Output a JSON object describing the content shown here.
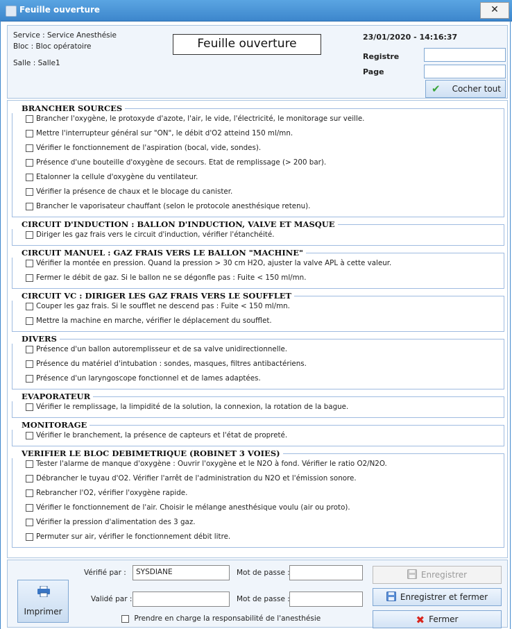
{
  "window": {
    "title": "Feuille ouverture",
    "close_glyph": "✕"
  },
  "header": {
    "service": "Service : Service Anesthésie",
    "bloc": "Bloc : Bloc opératoire",
    "salle": "Salle : Salle1",
    "doc_title": "Feuille ouverture",
    "datetime": "23/01/2020 - 14:16:37",
    "registre_label": "Registre",
    "registre_value": "",
    "page_label": "Page",
    "page_value": "",
    "check_all_label": "Cocher tout"
  },
  "sections": [
    {
      "title": "BRANCHER SOURCES",
      "items": [
        "Brancher l'oxygène, le protoxyde d'azote, l'air, le vide, l'électricité, le monitorage sur veille.",
        "Mettre l'interrupteur général sur \"ON\", le débit d'O2 atteind 150 ml/mn.",
        "Vérifier le fonctionnement de l'aspiration (bocal, vide, sondes).",
        "Présence d'une bouteille d'oxygène de secours. Etat de remplissage (> 200 bar).",
        "Etalonner la cellule d'oxygène du ventilateur.",
        "Vérifier la présence de chaux et le blocage du canister.",
        "Brancher le vaporisateur chauffant (selon le protocole anesthésique retenu)."
      ]
    },
    {
      "title": "CIRCUIT D'INDUCTION : BALLON D'INDUCTION, VALVE ET MASQUE",
      "items": [
        "Diriger les gaz frais vers le circuit d'induction, vérifier l'étanchéité."
      ]
    },
    {
      "title": "CIRCUIT MANUEL : GAZ FRAIS VERS LE BALLON \"MACHINE\"",
      "items": [
        "Vérifier la montée en pression. Quand la pression > 30 cm H2O, ajuster la valve APL à cette valeur.",
        "Fermer le débit de gaz. Si le ballon ne se dégonfle pas : Fuite < 150 ml/mn."
      ]
    },
    {
      "title": "CIRCUIT VC : DIRIGER LES GAZ FRAIS VERS LE SOUFFLET",
      "items": [
        "Couper les gaz frais. Si le soufflet ne descend pas : Fuite < 150 ml/mn.",
        "Mettre la machine en marche, vérifier le déplacement du soufflet."
      ]
    },
    {
      "title": "DIVERS",
      "items": [
        "Présence d'un ballon autoremplisseur et de sa valve unidirectionnelle.",
        "Présence du matériel d'intubation : sondes, masques, filtres antibactériens.",
        "Présence d'un laryngoscope fonctionnel et de lames adaptées."
      ]
    },
    {
      "title": "EVAPORATEUR",
      "items": [
        "Vérifier le remplissage, la limpidité de la solution, la connexion, la rotation de la bague."
      ]
    },
    {
      "title": "MONITORAGE",
      "items": [
        "Vérifier le branchement, la présence de capteurs et l'état de propreté."
      ]
    },
    {
      "title": "VERIFIER LE BLOC DEBIMETRIQUE (ROBINET 3 VOIES)",
      "items": [
        "Tester l'alarme de manque d'oxygène : Ouvrir l'oxygène et le N2O à fond. Vérifier le ratio O2/N2O.",
        "Débrancher le tuyau d'O2. Vérifier l'arrêt de l'administration du N2O et l'émission sonore.",
        "Rebrancher l'O2, vérifier l'oxygène rapide.",
        "Vérifier le fonctionnement de l'air. Choisir le mélange anesthésique voulu (air ou proto).",
        "Vérifier la pression d'alimentation des 3 gaz.",
        "Permuter sur air, vérifier le fonctionnement débit litre."
      ]
    }
  ],
  "footer": {
    "print_label": "Imprimer",
    "verified_by_label": "Vérifié par :",
    "verified_by_value": "SYSDIANE",
    "validated_by_label": "Validé par :",
    "validated_by_value": "",
    "password_label": "Mot de passe :",
    "password1_value": "",
    "password2_value": "",
    "save_label": "Enregistrer",
    "save_close_label": "Enregistrer et fermer",
    "close_label": "Fermer",
    "accept_label": "Prendre en charge la responsabilité de l'anesthésie"
  },
  "colors": {
    "titlebar": "#3d86cc",
    "accent_check": "#3aa53a",
    "close_x": "#d9251d",
    "save_icon": "#5b8fd6"
  },
  "icons": {
    "app": "app-icon",
    "check": "checkmark-icon",
    "printer": "printer-icon",
    "save": "floppy-disk-icon",
    "close": "red-x-icon"
  }
}
